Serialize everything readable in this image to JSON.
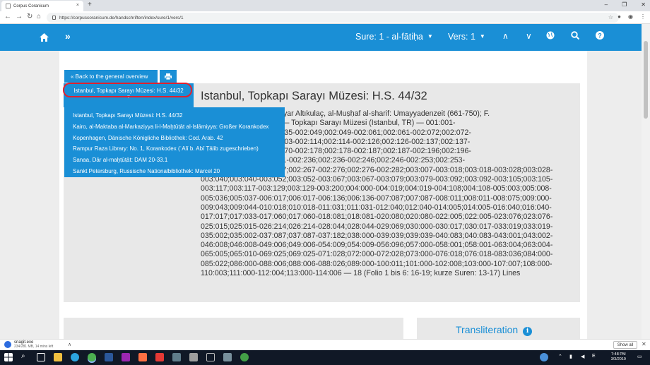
{
  "browser": {
    "tab_title": "Corpus Coranicum",
    "url": "https://corpuscoranicum.de/handschriften/index/sure/1/vers/1",
    "new_tab": "+",
    "tab_close": "×",
    "window_controls": [
      "–",
      "❐",
      "✕"
    ]
  },
  "header": {
    "home_icon": "home-icon",
    "expand_label": "»",
    "sure_label": "Sure: 1 - al-fātiḥa",
    "vers_label": "Vers: 1",
    "accent_color": "#1a8fd6"
  },
  "toolbar": {
    "back_label": "« Back to the general overview",
    "print_icon": "print-icon"
  },
  "manuscript_dropdown": {
    "selected": "Istanbul, Topkapı Sarayı Müzesi: H.S. 44/32",
    "items": [
      "Istanbul, Topkapı Sarayı Müzesi: H.S. 44/32",
      "Kairo, al-Maktaba al-Markaziyya li-l-Maḫṭūṭāt al-Islāmiyya: Großer Korankodex",
      "Kopenhagen, Dänische Königliche Bibliothek: Cod. Arab. 42",
      "Rampur Raza Library: No. 1, Korankodex (ʿAlī b. Abī Ṭālib zugeschrieben)",
      "Sanaa, Dār al-maḫṭūṭāt: DAM 20-33.1",
      "Sankt Petersburg, Russische Nationalbibliothek: Marcel 20"
    ]
  },
  "manuscript": {
    "title": "Istanbul, Topkapı Sarayı Müzesi: H.S. 44/32",
    "description_lines": [
      "n) — 410x460mm — Tayyar Altıkulaç, al-Muṣḥaf al-sharif: Umayyadenzeit (661-750); F.",
      "on: 8. Jh. — Pergament — Topkapı Sarayı Müzesi (Istanbul, TR) — 001:001-",
      "5;002:024-003:007;002:035-002:049;002:049-002:061;002:061-002:072;002:072-",
      "2;002:093-002:103;002:103-002:114;002:114-002:126;002:126-002:137;002:137-",
      "9;002:159-002:170;002:170-002:178;002:178-002:187;002:187-002:196;002:196-",
      "002:222-002:231;002:231-002:236;002:236-002:246;002:246-002:253;002:253-",
      "002:259;002:259-002:267;002:267-002:276;002:276-002:282;003:007-003:018;003:018-003:028;003:028-",
      "003:040;003:040-003:052;003:052-003:067;003:067-003:079;003:079-003:092;003:092-003:105;003:105-",
      "003:117;003:117-003:129;003:129-003:200;004:000-004:019;004:019-004:108;004:108-005:003;005:008-",
      "005:036;005:037-006:017;006:017-006:136;006:136-007:087;007:087-008:011;008:011-008:075;009:000-",
      "009:043;009:044-010:018;010:018-011:031;011:031-012:040;012:040-014:005;014:005-016:040;016:040-",
      "017:017;017:033-017:060;017:060-018:081;018:081-020:080;020:080-022:005;022:005-023:076;023:076-",
      "025:015;025:015-026:214;026:214-028:044;028:044-029:069;030:000-030:017;030:017-033:019;033:019-",
      "035:002;035:002-037:087;037:087-037:182;038:000-039:039;039:039-040:083;040:083-043:001;043:002-",
      "046:008;046:008-049:006;049:006-054:009;054:009-056:096;057:000-058:001;058:001-063:004;063:004-",
      "065:005;065:010-069:025;069:025-071:028;072:000-072:028;073:000-076:018;076:018-083:036;084:000-",
      "085:022;086:000-088:006;088:006-088:026;089:000-100:011;101:000-102:008;103:000-107:007;108:000-",
      "110:003;111:000-112:004;113:000-114:006 — 18 (Folio 1 bis 6: 16-19; kurze Suren: 13-17) Lines"
    ]
  },
  "transliteration": {
    "label": "Transliteration",
    "info": "i"
  },
  "downloads": {
    "file_name": "snagit.exe",
    "status": "234/281 MB, 14 mins left",
    "show_all": "Show all",
    "close": "✕"
  },
  "taskbar": {
    "time": "7:48 PM",
    "date": "3/3/2019",
    "language": "E"
  }
}
